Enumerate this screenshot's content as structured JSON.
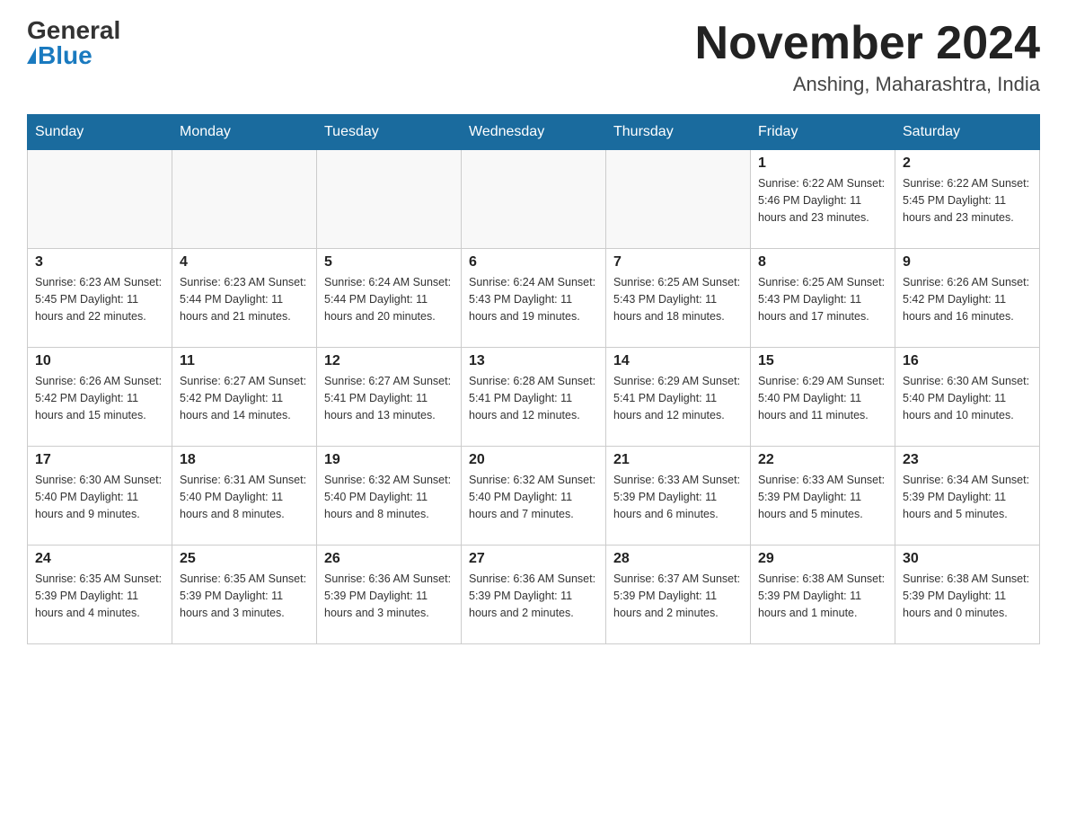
{
  "header": {
    "logo_general": "General",
    "logo_blue": "Blue",
    "month_title": "November 2024",
    "location": "Anshing, Maharashtra, India"
  },
  "days_of_week": [
    "Sunday",
    "Monday",
    "Tuesday",
    "Wednesday",
    "Thursday",
    "Friday",
    "Saturday"
  ],
  "weeks": [
    [
      {
        "day": "",
        "info": ""
      },
      {
        "day": "",
        "info": ""
      },
      {
        "day": "",
        "info": ""
      },
      {
        "day": "",
        "info": ""
      },
      {
        "day": "",
        "info": ""
      },
      {
        "day": "1",
        "info": "Sunrise: 6:22 AM\nSunset: 5:46 PM\nDaylight: 11 hours\nand 23 minutes."
      },
      {
        "day": "2",
        "info": "Sunrise: 6:22 AM\nSunset: 5:45 PM\nDaylight: 11 hours\nand 23 minutes."
      }
    ],
    [
      {
        "day": "3",
        "info": "Sunrise: 6:23 AM\nSunset: 5:45 PM\nDaylight: 11 hours\nand 22 minutes."
      },
      {
        "day": "4",
        "info": "Sunrise: 6:23 AM\nSunset: 5:44 PM\nDaylight: 11 hours\nand 21 minutes."
      },
      {
        "day": "5",
        "info": "Sunrise: 6:24 AM\nSunset: 5:44 PM\nDaylight: 11 hours\nand 20 minutes."
      },
      {
        "day": "6",
        "info": "Sunrise: 6:24 AM\nSunset: 5:43 PM\nDaylight: 11 hours\nand 19 minutes."
      },
      {
        "day": "7",
        "info": "Sunrise: 6:25 AM\nSunset: 5:43 PM\nDaylight: 11 hours\nand 18 minutes."
      },
      {
        "day": "8",
        "info": "Sunrise: 6:25 AM\nSunset: 5:43 PM\nDaylight: 11 hours\nand 17 minutes."
      },
      {
        "day": "9",
        "info": "Sunrise: 6:26 AM\nSunset: 5:42 PM\nDaylight: 11 hours\nand 16 minutes."
      }
    ],
    [
      {
        "day": "10",
        "info": "Sunrise: 6:26 AM\nSunset: 5:42 PM\nDaylight: 11 hours\nand 15 minutes."
      },
      {
        "day": "11",
        "info": "Sunrise: 6:27 AM\nSunset: 5:42 PM\nDaylight: 11 hours\nand 14 minutes."
      },
      {
        "day": "12",
        "info": "Sunrise: 6:27 AM\nSunset: 5:41 PM\nDaylight: 11 hours\nand 13 minutes."
      },
      {
        "day": "13",
        "info": "Sunrise: 6:28 AM\nSunset: 5:41 PM\nDaylight: 11 hours\nand 12 minutes."
      },
      {
        "day": "14",
        "info": "Sunrise: 6:29 AM\nSunset: 5:41 PM\nDaylight: 11 hours\nand 12 minutes."
      },
      {
        "day": "15",
        "info": "Sunrise: 6:29 AM\nSunset: 5:40 PM\nDaylight: 11 hours\nand 11 minutes."
      },
      {
        "day": "16",
        "info": "Sunrise: 6:30 AM\nSunset: 5:40 PM\nDaylight: 11 hours\nand 10 minutes."
      }
    ],
    [
      {
        "day": "17",
        "info": "Sunrise: 6:30 AM\nSunset: 5:40 PM\nDaylight: 11 hours\nand 9 minutes."
      },
      {
        "day": "18",
        "info": "Sunrise: 6:31 AM\nSunset: 5:40 PM\nDaylight: 11 hours\nand 8 minutes."
      },
      {
        "day": "19",
        "info": "Sunrise: 6:32 AM\nSunset: 5:40 PM\nDaylight: 11 hours\nand 8 minutes."
      },
      {
        "day": "20",
        "info": "Sunrise: 6:32 AM\nSunset: 5:40 PM\nDaylight: 11 hours\nand 7 minutes."
      },
      {
        "day": "21",
        "info": "Sunrise: 6:33 AM\nSunset: 5:39 PM\nDaylight: 11 hours\nand 6 minutes."
      },
      {
        "day": "22",
        "info": "Sunrise: 6:33 AM\nSunset: 5:39 PM\nDaylight: 11 hours\nand 5 minutes."
      },
      {
        "day": "23",
        "info": "Sunrise: 6:34 AM\nSunset: 5:39 PM\nDaylight: 11 hours\nand 5 minutes."
      }
    ],
    [
      {
        "day": "24",
        "info": "Sunrise: 6:35 AM\nSunset: 5:39 PM\nDaylight: 11 hours\nand 4 minutes."
      },
      {
        "day": "25",
        "info": "Sunrise: 6:35 AM\nSunset: 5:39 PM\nDaylight: 11 hours\nand 3 minutes."
      },
      {
        "day": "26",
        "info": "Sunrise: 6:36 AM\nSunset: 5:39 PM\nDaylight: 11 hours\nand 3 minutes."
      },
      {
        "day": "27",
        "info": "Sunrise: 6:36 AM\nSunset: 5:39 PM\nDaylight: 11 hours\nand 2 minutes."
      },
      {
        "day": "28",
        "info": "Sunrise: 6:37 AM\nSunset: 5:39 PM\nDaylight: 11 hours\nand 2 minutes."
      },
      {
        "day": "29",
        "info": "Sunrise: 6:38 AM\nSunset: 5:39 PM\nDaylight: 11 hours\nand 1 minute."
      },
      {
        "day": "30",
        "info": "Sunrise: 6:38 AM\nSunset: 5:39 PM\nDaylight: 11 hours\nand 0 minutes."
      }
    ]
  ]
}
